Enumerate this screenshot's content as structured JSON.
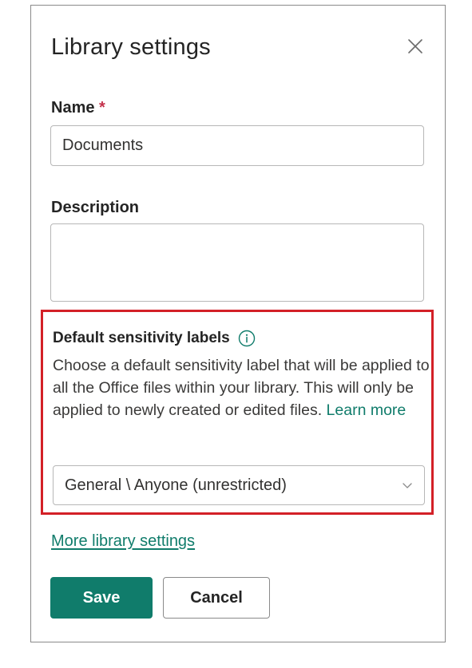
{
  "panel": {
    "title": "Library settings",
    "close_icon": "close-icon"
  },
  "name_field": {
    "label": "Name",
    "required_mark": "*",
    "value": "Documents"
  },
  "description_field": {
    "label": "Description",
    "value": ""
  },
  "sensitivity": {
    "label": "Default sensitivity labels",
    "info_icon": "info-icon",
    "description": "Choose a default sensitivity label that will be applied to all the Office files within your library. This will only be applied to newly created or edited files.",
    "learn_more": "Learn more",
    "selected_value": "General \\ Anyone (unrestricted)",
    "highlight_color": "#d32027"
  },
  "more_settings_link": "More library settings",
  "buttons": {
    "save": "Save",
    "cancel": "Cancel"
  },
  "colors": {
    "accent": "#107c6b",
    "required": "#c4314b"
  }
}
